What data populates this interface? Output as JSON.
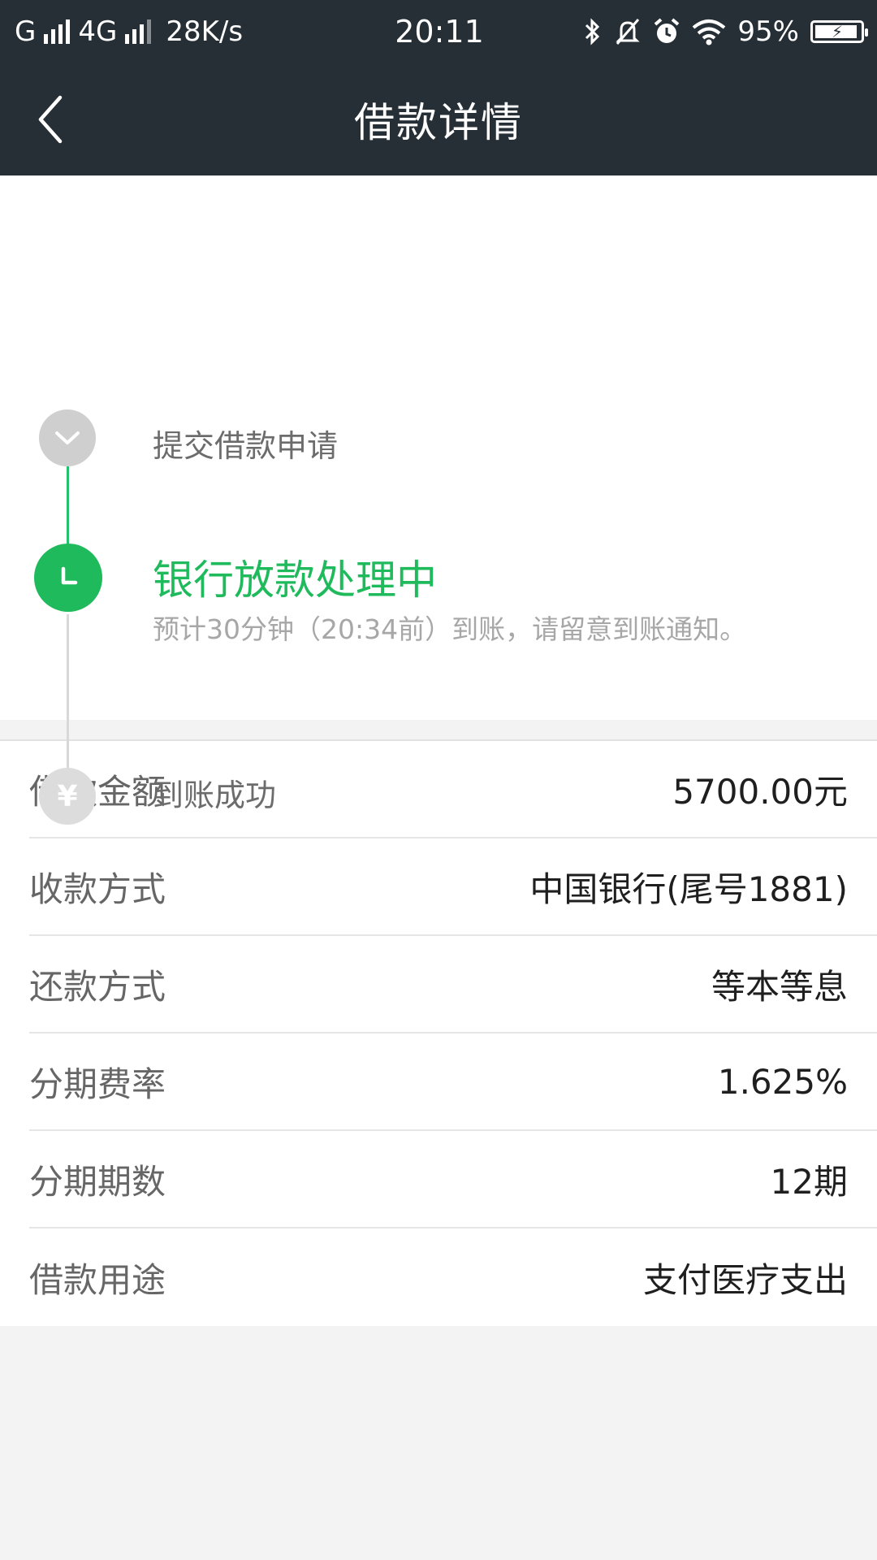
{
  "status_bar": {
    "carrier1": "G",
    "carrier2": "4G",
    "net_speed": "28K/s",
    "time": "20:11",
    "battery_percent": "95%",
    "battery_level": 0.95,
    "icons": [
      "signal-icon",
      "bluetooth-icon",
      "mute-bell-icon",
      "alarm-icon",
      "wifi-icon",
      "battery-icon"
    ]
  },
  "header": {
    "title": "借款详情",
    "back_icon": "chevron-left-icon"
  },
  "progress": {
    "steps": [
      {
        "label": "提交借款申请",
        "state": "done",
        "icon": "check-icon"
      },
      {
        "label": "银行放款处理中",
        "subtitle": "预计30分钟（20:34前）到账，请留意到账通知。",
        "state": "active",
        "icon": "clock-icon"
      },
      {
        "label": "到账成功",
        "state": "todo",
        "icon": "yen-icon",
        "glyph": "¥"
      }
    ]
  },
  "details": {
    "rows": [
      {
        "key": "借款金额",
        "value": "5700.00元"
      },
      {
        "key": "收款方式",
        "value": "中国银行(尾号1881)"
      },
      {
        "key": "还款方式",
        "value": "等本等息"
      },
      {
        "key": "分期费率",
        "value": "1.625%"
      },
      {
        "key": "分期期数",
        "value": "12期"
      },
      {
        "key": "借款用途",
        "value": "支付医疗支出"
      }
    ]
  },
  "colors": {
    "header_bg": "#262f36",
    "accent_green": "#1fba5c",
    "page_bg": "#f3f3f3"
  }
}
